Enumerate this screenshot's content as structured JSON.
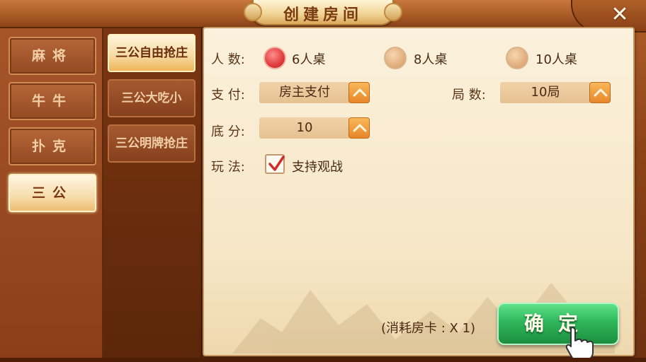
{
  "window": {
    "title": "创建房间"
  },
  "categories": [
    {
      "label": "麻将",
      "active": false
    },
    {
      "label": "牛牛",
      "active": false
    },
    {
      "label": "扑克",
      "active": false
    },
    {
      "label": "三公",
      "active": true
    }
  ],
  "modes": [
    {
      "label": "三公自由抢庄",
      "active": true
    },
    {
      "label": "三公大吃小",
      "active": false
    },
    {
      "label": "三公明牌抢庄",
      "active": false
    }
  ],
  "form": {
    "players": {
      "label": "人  数:",
      "options": [
        {
          "label": "6人桌",
          "selected": true
        },
        {
          "label": "8人桌",
          "selected": false
        },
        {
          "label": "10人桌",
          "selected": false
        }
      ]
    },
    "payment": {
      "label": "支  付:",
      "value": "房主支付"
    },
    "rounds": {
      "label": "局  数:",
      "value": "10局"
    },
    "base_score": {
      "label": "底  分:",
      "value": "10"
    },
    "rules": {
      "label": "玩  法:",
      "option": "支持观战",
      "checked": true
    }
  },
  "footer": {
    "cost_text": "(消耗房卡 : X 1)",
    "confirm_label": "确定"
  },
  "colors": {
    "accent_green": "#2fb65c",
    "radio_selected": "#e03c3c",
    "arrow_orange": "#e8862a"
  }
}
